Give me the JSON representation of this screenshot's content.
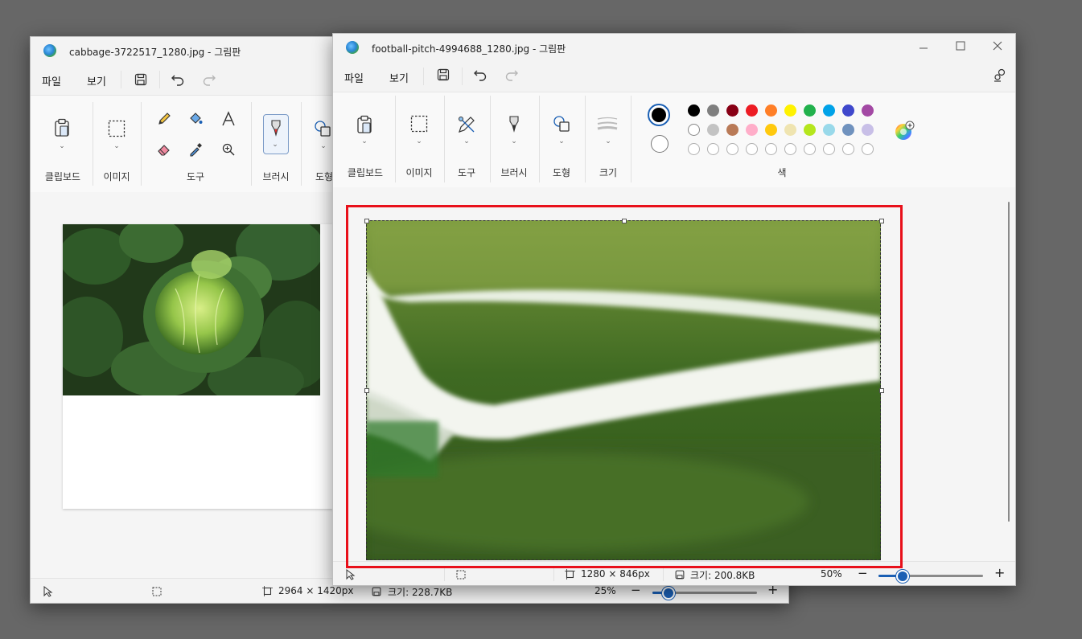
{
  "back_window": {
    "title": "cabbage-3722517_1280.jpg - 그림판",
    "menu": {
      "file": "파일",
      "view": "보기"
    },
    "ribbon": {
      "clipboard": "클립보드",
      "image": "이미지",
      "tools": "도구",
      "brushes": "브러시",
      "shapes": "도형"
    },
    "status": {
      "dimensions": "2964 × 1420px",
      "size": "크기: 228.7KB",
      "zoom": "25%"
    }
  },
  "front_window": {
    "title": "football-pitch-4994688_1280.jpg - 그림판",
    "menu": {
      "file": "파일",
      "view": "보기"
    },
    "ribbon": {
      "clipboard": "클립보드",
      "image": "이미지",
      "tools": "도구",
      "brushes": "브러시",
      "shapes": "도형",
      "size": "크기",
      "colors": "색"
    },
    "palette_row1": [
      "#000000",
      "#7f7f7f",
      "#880015",
      "#ed1c24",
      "#ff7f27",
      "#fff200",
      "#22b14c",
      "#00a2e8",
      "#3f48cc",
      "#a349a4"
    ],
    "palette_row2": [
      "#ffffff",
      "#c3c3c3",
      "#b97a57",
      "#ffaec9",
      "#ffc90e",
      "#efe4b0",
      "#b5e61d",
      "#99d9ea",
      "#7092be",
      "#c8bfe7"
    ],
    "status": {
      "dimensions": "1280 × 846px",
      "size": "크기: 200.8KB",
      "zoom": "50%"
    }
  },
  "colors": {
    "highlight": "#e8101a",
    "accent": "#1a5fb4",
    "desktop": "#676767"
  },
  "icons": [
    "paint-app-icon",
    "save-icon",
    "undo-icon",
    "redo-icon",
    "clipboard-icon",
    "select-icon",
    "pencil-icon",
    "fill-icon",
    "text-icon",
    "eraser-icon",
    "color-picker-icon",
    "magnifier-icon",
    "brush-icon",
    "shapes-icon",
    "size-icon",
    "edit-colors-icon",
    "minimize-icon",
    "maximize-icon",
    "close-icon",
    "cursor-icon",
    "selection-icon",
    "canvas-size-icon",
    "zoom-out-icon",
    "zoom-in-icon",
    "settings-icon"
  ]
}
